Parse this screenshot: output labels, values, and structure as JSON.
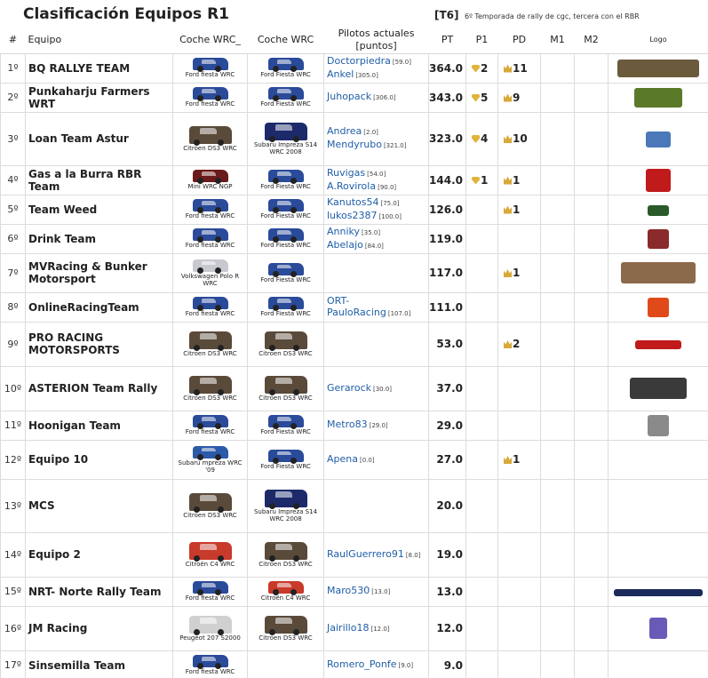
{
  "header": {
    "title": "Clasificación Equipos R1",
    "season_code": "[T6]",
    "season_desc": "6º Temporada de rally de cgc, tercera con el RBR"
  },
  "columns": {
    "pos": "#",
    "team": "Equipo",
    "car1": "Coche WRC_",
    "car2": "Coche WRC",
    "pilots_line1": "Pilotos actuales",
    "pilots_line2": "[puntos]",
    "pt": "PT",
    "p1": "P1",
    "pd": "PD",
    "m1": "M1",
    "m2": "M2",
    "logo": "Logo"
  },
  "rows": [
    {
      "pos": "1º",
      "team": "BQ RALLYE TEAM",
      "car1": "Ford fiesta WRC",
      "car1_color": "#2a4a9a",
      "car2": "Ford Fiesta WRC",
      "car2_color": "#2a4a9a",
      "pilots": [
        {
          "name": "Doctorpiedra",
          "pts": "[59.0]"
        },
        {
          "name": "Ankel",
          "pts": "[305.0]"
        }
      ],
      "pt": "364.0",
      "p1": "2",
      "pd": "11",
      "m1": "",
      "m2": "",
      "logo_color": "#6b5a3c"
    },
    {
      "pos": "2º",
      "team": "Punkaharju Farmers WRT",
      "car1": "Ford fiesta WRC",
      "car1_color": "#2a4a9a",
      "car2": "Ford Fiesta WRC",
      "car2_color": "#2a4a9a",
      "pilots": [
        {
          "name": "Juhopack",
          "pts": "[306.0]"
        }
      ],
      "pt": "343.0",
      "p1": "5",
      "pd": "9",
      "m1": "",
      "m2": "",
      "logo_color": "#5a7a2a"
    },
    {
      "pos": "3º",
      "team": "Loan Team Astur",
      "car1": "Citroen DS3 WRC",
      "car1_color": "#5a4a3a",
      "car2": "Subaru Impreza S14 WRC 2008",
      "car2_color": "#1c2a6a",
      "pilots": [
        {
          "name": "Andrea",
          "pts": "[2.0]"
        },
        {
          "name": "Mendyrubo",
          "pts": "[321.0]"
        }
      ],
      "pt": "323.0",
      "p1": "4",
      "pd": "10",
      "m1": "",
      "m2": "",
      "logo_color": "#4a78b8"
    },
    {
      "pos": "4º",
      "team": "Gas a la Burra RBR Team",
      "car1": "Mini WRC NGP",
      "car1_color": "#6a1a1a",
      "car2": "Ford Fiesta WRC",
      "car2_color": "#2a4a9a",
      "pilots": [
        {
          "name": "Ruvigas",
          "pts": "[54.0]"
        },
        {
          "name": "A.Rovirola",
          "pts": "[90.0]"
        }
      ],
      "pt": "144.0",
      "p1": "1",
      "pd": "1",
      "m1": "",
      "m2": "",
      "logo_color": "#c01a1a"
    },
    {
      "pos": "5º",
      "team": "Team Weed",
      "car1": "Ford fiesta WRC",
      "car1_color": "#2a4a9a",
      "car2": "Ford Fiesta WRC",
      "car2_color": "#2a4a9a",
      "pilots": [
        {
          "name": "Kanutos54",
          "pts": "[75.0]"
        },
        {
          "name": "lukos2387",
          "pts": "[100.0]"
        }
      ],
      "pt": "126.0",
      "p1": "",
      "pd": "1",
      "m1": "",
      "m2": "",
      "logo_color": "#2a5a2a"
    },
    {
      "pos": "6º",
      "team": "Drink Team",
      "car1": "Ford fiesta WRC",
      "car1_color": "#2a4a9a",
      "car2": "Ford Fiesta WRC",
      "car2_color": "#2a4a9a",
      "pilots": [
        {
          "name": "Anniky",
          "pts": "[35.0]"
        },
        {
          "name": "Abelajo",
          "pts": "[84.0]"
        }
      ],
      "pt": "119.0",
      "p1": "",
      "pd": "",
      "m1": "",
      "m2": "",
      "logo_color": "#8a2a2a"
    },
    {
      "pos": "7º",
      "team": "MVRacing & Bunker Motorsport",
      "car1": "Volkswagen Polo R WRC",
      "car1_color": "#c8c8d0",
      "car2": "Ford Fiesta WRC",
      "car2_color": "#2a4a9a",
      "pilots": [],
      "pt": "117.0",
      "p1": "",
      "pd": "1",
      "m1": "",
      "m2": "",
      "logo_color": "#8a6a4a"
    },
    {
      "pos": "8º",
      "team": "OnlineRacingTeam",
      "car1": "Ford fiesta WRC",
      "car1_color": "#2a4a9a",
      "car2": "Ford Fiesta WRC",
      "car2_color": "#2a4a9a",
      "pilots": [
        {
          "name": "ORT-PauloRacing",
          "pts": "[107.0]"
        }
      ],
      "pt": "111.0",
      "p1": "",
      "pd": "",
      "m1": "",
      "m2": "",
      "logo_color": "#e04a1a"
    },
    {
      "pos": "9º",
      "team": "PRO RACING MOTORSPORTS",
      "car1": "Citroen DS3 WRC",
      "car1_color": "#5a4a3a",
      "car2": "Citroen DS3 WRC",
      "car2_color": "#5a4a3a",
      "pilots": [],
      "pt": "53.0",
      "p1": "",
      "pd": "2",
      "m1": "",
      "m2": "",
      "logo_color": "#c01a1a"
    },
    {
      "pos": "10º",
      "team": "ASTERION Team Rally",
      "car1": "Citroen DS3 WRC",
      "car1_color": "#5a4a3a",
      "car2": "Citroen DS3 WRC",
      "car2_color": "#5a4a3a",
      "pilots": [
        {
          "name": "Gerarock",
          "pts": "[30.0]"
        }
      ],
      "pt": "37.0",
      "p1": "",
      "pd": "",
      "m1": "",
      "m2": "",
      "logo_color": "#3a3a3a"
    },
    {
      "pos": "11º",
      "team": "Hoonigan Team",
      "car1": "Ford fiesta WRC",
      "car1_color": "#2a4a9a",
      "car2": "Ford Fiesta WRC",
      "car2_color": "#2a4a9a",
      "pilots": [
        {
          "name": "Metro83",
          "pts": "[29.0]"
        }
      ],
      "pt": "29.0",
      "p1": "",
      "pd": "",
      "m1": "",
      "m2": "",
      "logo_color": "#8a8a8a"
    },
    {
      "pos": "12º",
      "team": "Equipo 10",
      "car1": "Subaru mpreza WRC '09",
      "car1_color": "#2a5aa8",
      "car2": "Ford Fiesta WRC",
      "car2_color": "#2a4a9a",
      "pilots": [
        {
          "name": "Apena",
          "pts": "[0.0]"
        }
      ],
      "pt": "27.0",
      "p1": "",
      "pd": "1",
      "m1": "",
      "m2": "",
      "logo_color": ""
    },
    {
      "pos": "13º",
      "team": "MCS",
      "car1": "Citroen DS3 WRC",
      "car1_color": "#5a4a3a",
      "car2": "Subaru Impreza S14 WRC 2008",
      "car2_color": "#1c2a6a",
      "pilots": [],
      "pt": "20.0",
      "p1": "",
      "pd": "",
      "m1": "",
      "m2": "",
      "logo_color": ""
    },
    {
      "pos": "14º",
      "team": "Equipo 2",
      "car1": "Citroën C4 WRC",
      "car1_color": "#c83a2a",
      "car2": "Citroen DS3 WRC",
      "car2_color": "#5a4a3a",
      "pilots": [
        {
          "name": "RaulGuerrero91",
          "pts": "[8.0]"
        }
      ],
      "pt": "19.0",
      "p1": "",
      "pd": "",
      "m1": "",
      "m2": "",
      "logo_color": ""
    },
    {
      "pos": "15º",
      "team": "NRT- Norte Rally Team",
      "car1": "Ford fiesta WRC",
      "car1_color": "#2a4a9a",
      "car2": "Citroën C4 WRC",
      "car2_color": "#c83a2a",
      "pilots": [
        {
          "name": "Maro530",
          "pts": "[13.0]"
        }
      ],
      "pt": "13.0",
      "p1": "",
      "pd": "",
      "m1": "",
      "m2": "",
      "logo_color": "#1a2a5a"
    },
    {
      "pos": "16º",
      "team": "JM Racing",
      "car1": "Peugeot 207 S2000",
      "car1_color": "#d0d0d0",
      "car2": "Citroen DS3 WRC",
      "car2_color": "#5a4a3a",
      "pilots": [
        {
          "name": "Jairillo18",
          "pts": "[12.0]"
        }
      ],
      "pt": "12.0",
      "p1": "",
      "pd": "",
      "m1": "",
      "m2": "",
      "logo_color": "#6a5ab8"
    },
    {
      "pos": "17º",
      "team": "Sinsemilla Team",
      "car1": "Ford fiesta WRC",
      "car1_color": "#2a4a9a",
      "car2": "",
      "car2_color": "",
      "pilots": [
        {
          "name": "Romero_Ponfe",
          "pts": "[9.0]"
        }
      ],
      "pt": "9.0",
      "p1": "",
      "pd": "",
      "m1": "",
      "m2": "",
      "logo_color": ""
    }
  ]
}
